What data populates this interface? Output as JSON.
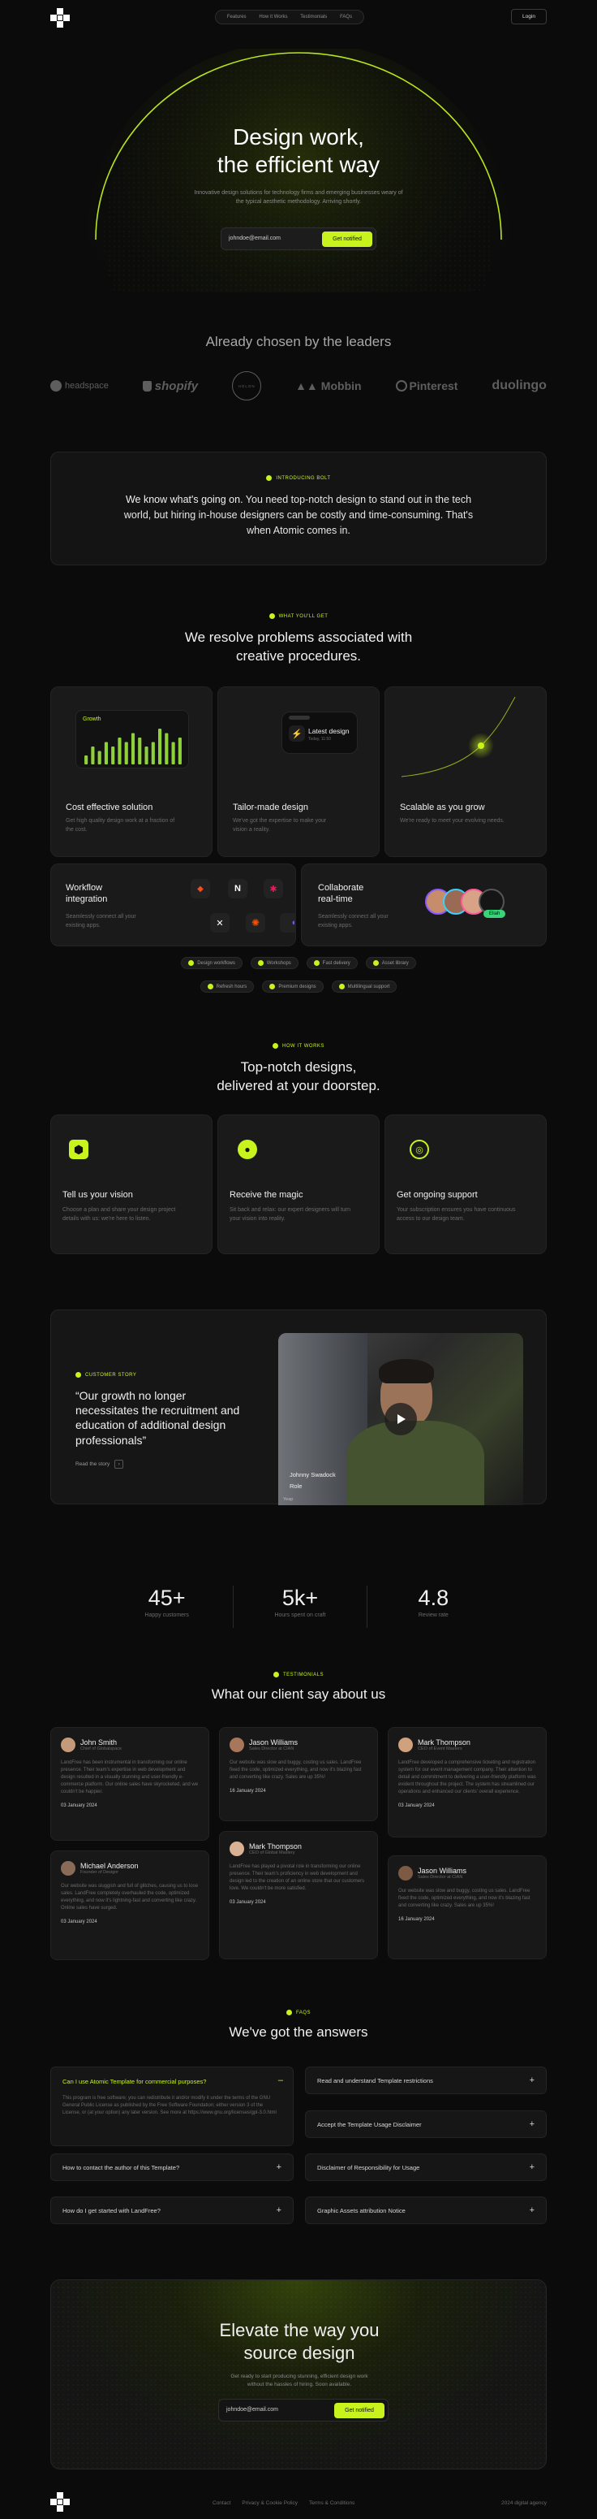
{
  "nav": {
    "links": [
      "Features",
      "How it Works",
      "Testimonials",
      "FAQs"
    ],
    "login": "Login"
  },
  "hero": {
    "title_line1": "Design work,",
    "title_line2": "the efficient way",
    "subtitle_line1": "Innovative design solutions for technology firms and emerging businesses weary of",
    "subtitle_line2": "the typical aesthetic methodology. Arriving shortly.",
    "email_value": "johndoe@email.com",
    "cta": "Get notified"
  },
  "logos": {
    "heading": "Already chosen by the leaders",
    "items": [
      "headspace",
      "shopify",
      "HOLON",
      "Mobbin",
      "Pinterest",
      "duolingo"
    ]
  },
  "intro": {
    "eyebrow": "INTRODUCING BOLT",
    "text_lead": "We know what's going on.",
    "text_rest": " You need top-notch design to stand out in the tech world, but hiring in-house designers can be costly and time-consuming. That's when Atomic comes in."
  },
  "features": {
    "eyebrow": "WHAT YOU'LL GET",
    "title_line1": "We resolve problems associated with",
    "title_line2": "creative procedures.",
    "growth_label": "Growth",
    "growth_values": [
      2,
      4,
      3,
      5,
      4,
      6,
      5,
      7,
      6,
      4,
      5,
      8,
      7,
      5,
      6
    ],
    "notif_title": "Latest design",
    "notif_sub": "Today, 11:50",
    "cards": [
      {
        "title": "Cost effective solution",
        "text": "Get high quality design work at a fraction of the cost."
      },
      {
        "title": "Tailor-made design",
        "text": "We've got the expertise to make your vision a reality."
      },
      {
        "title": "Scalable as you grow",
        "text": "We're ready to meet your evolving needs."
      },
      {
        "title_line1": "Workflow",
        "title_line2": "integration",
        "text_line1": "Seamlessly connect all your",
        "text_line2": "existing apps."
      },
      {
        "title_line1": "Collaborate",
        "title_line2": "real-time",
        "text_line1": "Seamlessly connect all your",
        "text_line2": "existing apps."
      }
    ],
    "eliah": "Eliah",
    "pills_row1": [
      "Design workflows",
      "Workshops",
      "Fast delivery",
      "Asset library"
    ],
    "pills_row2": [
      "Refresh hours",
      "Premium designs",
      "Multilingual support"
    ]
  },
  "how": {
    "eyebrow": "HOW IT WORKS",
    "title_line1": "Top-notch designs,",
    "title_line2": "delivered at your doorstep.",
    "steps": [
      {
        "title": "Tell us your vision",
        "text": "Choose a plan and share your design project details with us: we're here to listen."
      },
      {
        "title": "Receive the magic",
        "text": "Sit back and relax: our expert designers will turn your vision into reality."
      },
      {
        "title": "Get ongoing support",
        "text": "Your subscription ensures you have continuous access to our design team."
      }
    ]
  },
  "story": {
    "eyebrow": "CUSTOMER STORY",
    "quote": "“Our growth no longer necessitates the recruitment and education of additional design professionals”",
    "link": "Read the story",
    "person_name": "Johnny Swadock",
    "person_role": "Role",
    "corner_tag": "Yeap"
  },
  "stats": [
    {
      "value": "45+",
      "label": "Happy customers"
    },
    {
      "value": "5k+",
      "label": "Hours spent on craft"
    },
    {
      "value": "4.8",
      "label": "Review rate"
    }
  ],
  "testimonials": {
    "eyebrow": "TESTIMONIALS",
    "title": "What our client say about us",
    "items": [
      {
        "name": "John Smith",
        "role": "Chief of Globalspace",
        "text": "LandFree has been instrumental in transforming our online presence. Their team's expertise in web development and design resulted in a visually stunning and user-friendly e-commerce platform. Our online sales have skyrocketed, and we couldn't be happier.",
        "date": "03 January 2024"
      },
      {
        "name": "Michael Anderson",
        "role": "Founder of Designr",
        "text": "Our website was sluggish and full of glitches, causing us to lose sales. LandFree completely overhauled the code, optimized everything, and now it's lightning-fast and converting like crazy. Online sales have surged.",
        "date": "03 January 2024"
      },
      {
        "name": "Jason Williams",
        "role": "Sales Director at CIAN",
        "text": "Our website was slow and buggy, costing us sales. LandFree fixed the code, optimized everything, and now it's blazing fast and converting like crazy. Sales are up 35%!",
        "date": "16 January 2024"
      },
      {
        "name": "Mark Thompson",
        "role": "CEO of Global Mastery",
        "text": "LandFree has played a pivotal role in transforming our online presence. Their team's proficiency in web development and design led to the creation of an online store that our customers love. We couldn't be more satisfied.",
        "date": "03 January 2024"
      },
      {
        "name": "Mark Thompson",
        "role": "CEO of Event Masters",
        "text": "LandFree developed a comprehensive ticketing and registration system for our event management company. Their attention to detail and commitment to delivering a user-friendly platform was evident throughout the project. The system has streamlined our operations and enhanced our clients' overall experience.",
        "date": "03 January 2024"
      },
      {
        "name": "Jason Williams",
        "role": "Sales Director at CIAN",
        "text": "Our website was slow and buggy, costing us sales. LandFree fixed the code, optimized everything, and now it's blazing fast and converting like crazy. Sales are up 35%!",
        "date": "16 January 2024"
      }
    ]
  },
  "faq": {
    "eyebrow": "FAQS",
    "title": "We've got the answers",
    "open_q": "Can I use Atomic Template for commercial purposes?",
    "open_a": "This program is free software; you can redistribute it and/or modify it under the terms of the GNU General Public License as published by the Free Software Foundation; either version 3 of the License, or (at your option) any later version. See more at https://www.gnu.org/licenses/gpl-3.0.html",
    "left": [
      "How to contact the author of this Template?",
      "How do I get started with LandFree?"
    ],
    "right": [
      "Read and understand Template restrictions",
      "Accept the Template Usage Disclaimer",
      "Disclaimer of Responsibility for Usage",
      "Graphic Assets attribution Notice"
    ]
  },
  "cta": {
    "title_line1": "Elevate the way you",
    "title_line2": "source design",
    "text_line1": "Get ready to start producing stunning, efficient design work",
    "text_line2": "without the hassles of hiring. Soon available.",
    "email_value": "johndoe@email.com",
    "button": "Get notified"
  },
  "footer": {
    "links": [
      "Contact",
      "Privacy & Cookie Policy",
      "Terms & Conditions"
    ],
    "copyright": "2024 digital agency"
  }
}
